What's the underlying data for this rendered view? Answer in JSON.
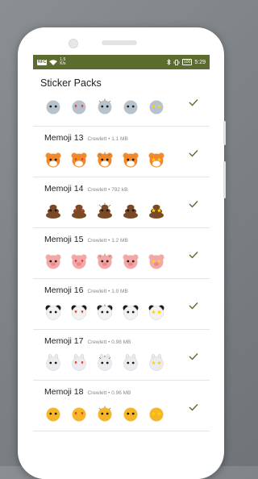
{
  "status_bar": {
    "carrier_badge": "NFC",
    "speed_top": "1.5",
    "speed_bottom": "K/s",
    "battery": "100",
    "time": "5:29",
    "color": "#5b6c2e"
  },
  "app": {
    "title": "Sticker Packs"
  },
  "packs": [
    {
      "name": "",
      "publisher": "",
      "size": "",
      "sticker_theme": "alien",
      "added": true
    },
    {
      "name": "Memoji 13",
      "publisher": "Crewlett",
      "size": "1.1 MB",
      "sticker_theme": "fox",
      "added": true
    },
    {
      "name": "Memoji 14",
      "publisher": "Crewlett",
      "size": "792 kB",
      "sticker_theme": "poop",
      "added": true
    },
    {
      "name": "Memoji 15",
      "publisher": "Crewlett",
      "size": "1.2 MB",
      "sticker_theme": "pig",
      "added": true
    },
    {
      "name": "Memoji 16",
      "publisher": "Crewlett",
      "size": "1.0 MB",
      "sticker_theme": "panda",
      "added": true
    },
    {
      "name": "Memoji 17",
      "publisher": "Crewlett",
      "size": "0.98 MB",
      "sticker_theme": "rabbit",
      "added": true
    },
    {
      "name": "Memoji 18",
      "publisher": "Crewlett",
      "size": "0.96 MB",
      "sticker_theme": "chick",
      "added": true
    }
  ],
  "separator": "•",
  "colors": {
    "check": "#5b6c2e",
    "background": "#7d8286"
  }
}
